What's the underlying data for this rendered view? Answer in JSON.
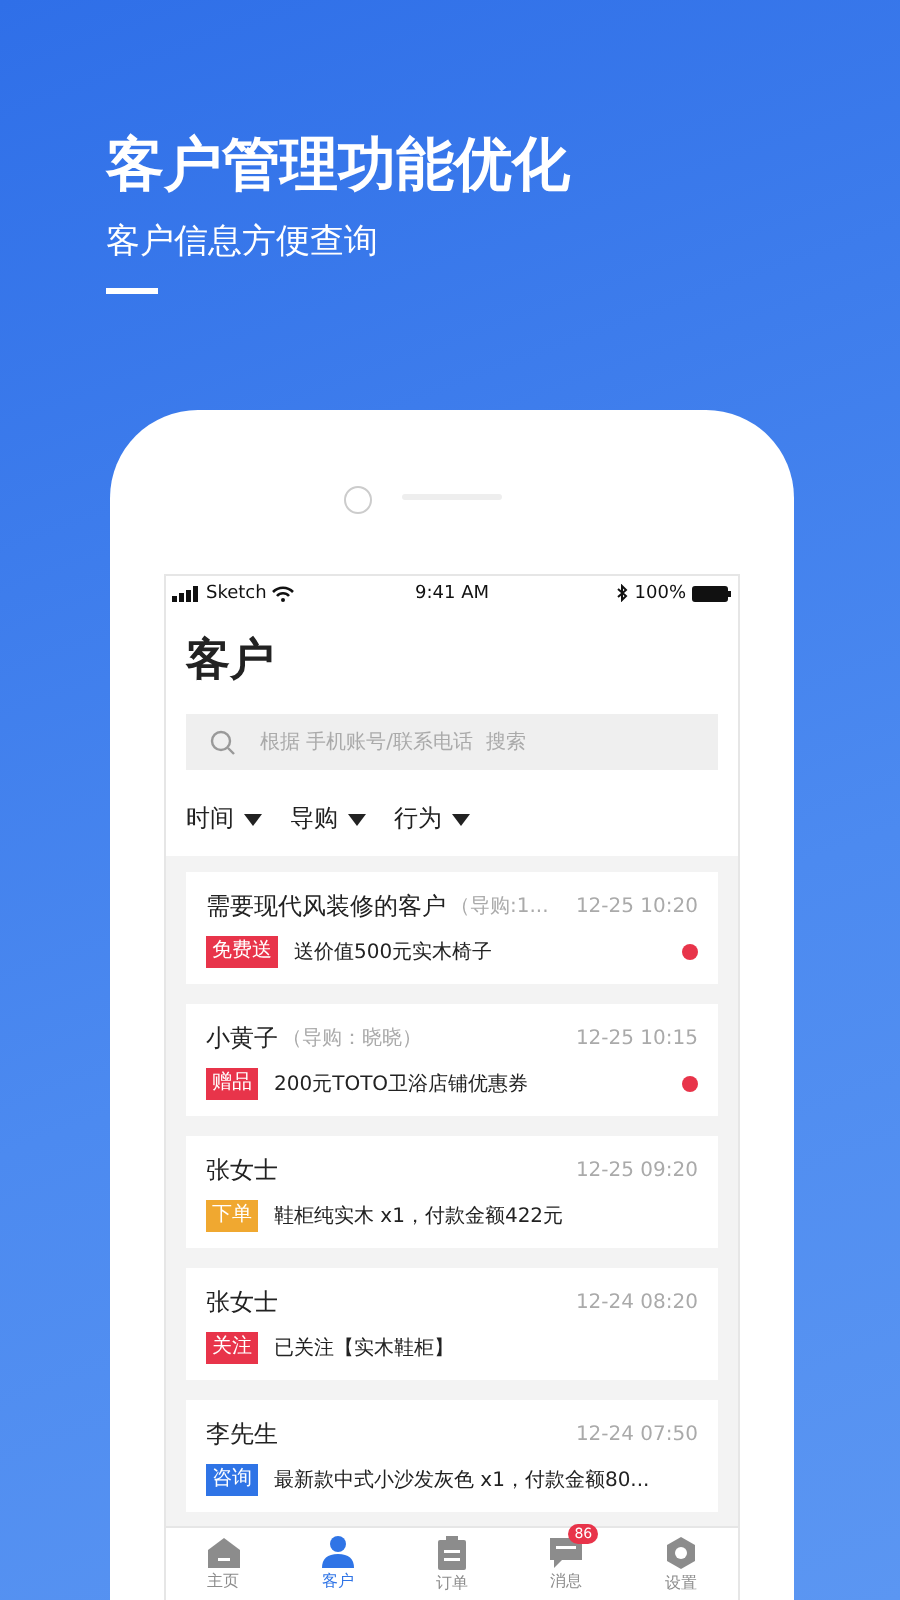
{
  "headline": "客户管理功能优化",
  "subtitle": "客户信息方便查询",
  "status_bar": {
    "carrier": "Sketch",
    "time": "9:41 AM",
    "battery": "100%"
  },
  "page_title": "客户",
  "search": {
    "placeholder": "根据 手机账号/联系电话  搜索"
  },
  "filters": [
    {
      "label": "时间"
    },
    {
      "label": "导购"
    },
    {
      "label": "行为"
    }
  ],
  "customers": [
    {
      "name": "需要现代风装修的客户",
      "guide": "（导购:1...",
      "time": "12-25 10:20",
      "tag": {
        "label": "免费送",
        "color": "#e8344a"
      },
      "text": "送价值500元实木椅子",
      "unread": true
    },
    {
      "name": "小黄子",
      "guide": "（导购：晓晓）",
      "time": "12-25 10:15",
      "tag": {
        "label": "赠品",
        "color": "#e8344a"
      },
      "text": "200元TOTO卫浴店铺优惠券",
      "unread": true
    },
    {
      "name": "张女士",
      "time": "12-25 09:20",
      "tag": {
        "label": "下单",
        "color": "#f0a830"
      },
      "text": "鞋柜纯实木 x1，付款金额422元",
      "unread": false
    },
    {
      "name": "张女士",
      "time": "12-24 08:20",
      "tag": {
        "label": "关注",
        "color": "#e8344a"
      },
      "text": "已关注【实木鞋柜】",
      "unread": false
    },
    {
      "name": "李先生",
      "time": "12-24 07:50",
      "tag": {
        "label": "咨询",
        "color": "#2f74e6"
      },
      "text": "最新款中式小沙发灰色 x1，付款金额80...",
      "unread": false
    }
  ],
  "tab_bar": [
    {
      "label": "主页",
      "selected": false
    },
    {
      "label": "客户",
      "selected": true
    },
    {
      "label": "订单",
      "selected": false
    },
    {
      "label": "消息",
      "selected": false,
      "badge": "86"
    },
    {
      "label": "设置",
      "selected": false
    }
  ]
}
